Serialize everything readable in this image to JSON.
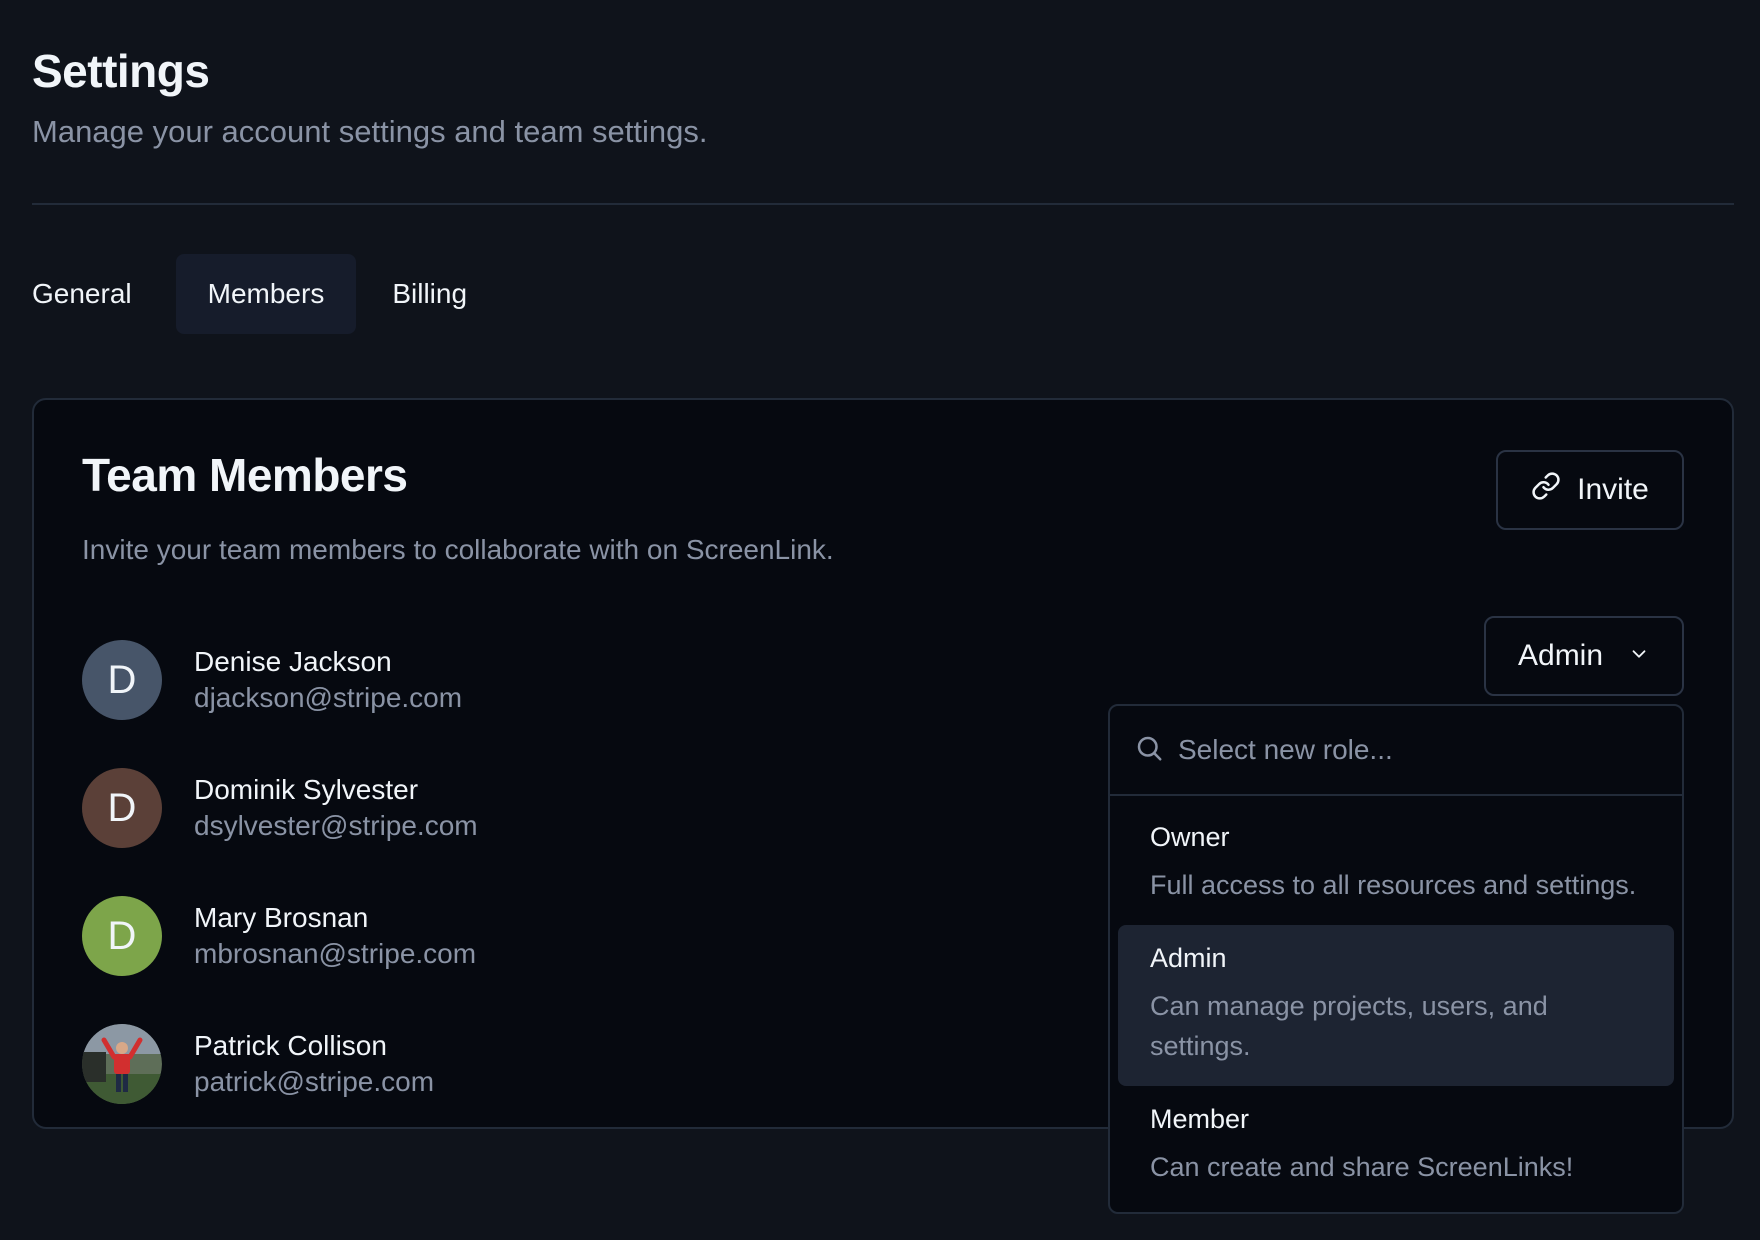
{
  "header": {
    "title": "Settings",
    "subtitle": "Manage your account settings and team settings."
  },
  "tabs": [
    {
      "label": "General",
      "active": false
    },
    {
      "label": "Members",
      "active": true
    },
    {
      "label": "Billing",
      "active": false
    }
  ],
  "team": {
    "title": "Team Members",
    "subtitle": "Invite your team members to collaborate with on ScreenLink.",
    "invite_label": "Invite",
    "invite_icon": "link-icon",
    "members": [
      {
        "initial": "D",
        "name": "Denise Jackson",
        "email": "djackson@stripe.com",
        "avatar_color": "#475569"
      },
      {
        "initial": "D",
        "name": "Dominik Sylvester",
        "email": "dsylvester@stripe.com",
        "avatar_color": "#5b4038"
      },
      {
        "initial": "D",
        "name": "Mary Brosnan",
        "email": "mbrosnan@stripe.com",
        "avatar_color": "#7da54a"
      },
      {
        "initial": "",
        "name": "Patrick Collison",
        "email": "patrick@stripe.com",
        "avatar_color": "#4a5a3c",
        "photo": true
      }
    ],
    "role_select": {
      "value": "Admin",
      "icon": "chevron-down-icon"
    }
  },
  "role_dropdown": {
    "search_placeholder": "Select new role...",
    "search_icon": "search-icon",
    "options": [
      {
        "name": "Owner",
        "description": "Full access to all resources and settings.",
        "selected": false
      },
      {
        "name": "Admin",
        "description": "Can manage projects, users, and settings.",
        "selected": true
      },
      {
        "name": "Member",
        "description": "Can create and share ScreenLinks!",
        "selected": false
      }
    ]
  },
  "colors": {
    "background": "#0f131b",
    "card": "#060910",
    "border": "#222b39",
    "muted_text": "#8a93a5",
    "selected_option": "#1d2432"
  }
}
